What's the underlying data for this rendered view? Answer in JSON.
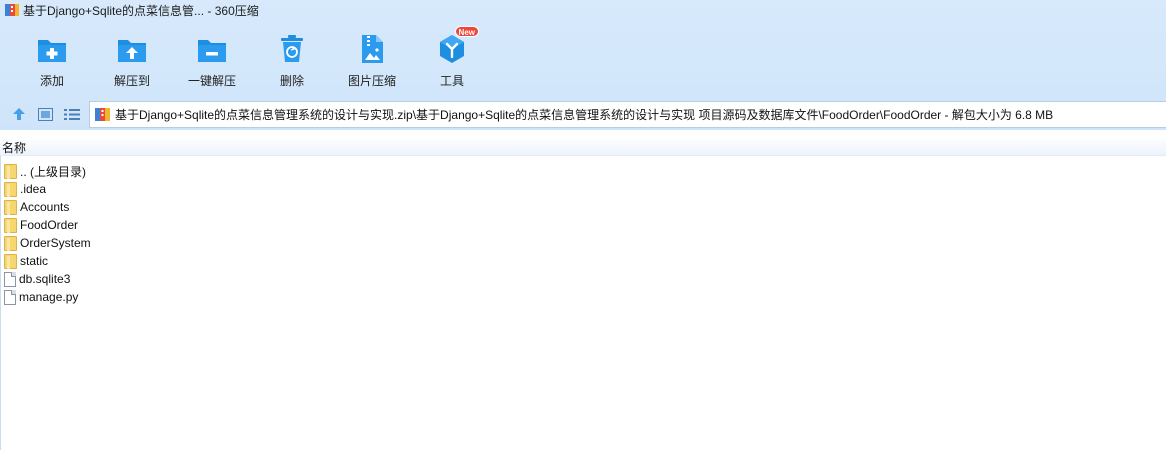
{
  "window": {
    "title": "基于Django+Sqlite的点菜信息管... - 360压缩"
  },
  "toolbar": {
    "items": [
      {
        "label": "添加",
        "icon": "add-icon"
      },
      {
        "label": "解压到",
        "icon": "extract-to-icon"
      },
      {
        "label": "一键解压",
        "icon": "one-click-extract-icon"
      },
      {
        "label": "删除",
        "icon": "delete-icon"
      },
      {
        "label": "图片压缩",
        "icon": "image-compress-icon"
      },
      {
        "label": "工具",
        "icon": "tools-icon",
        "badge": "New"
      }
    ]
  },
  "address": {
    "path": "基于Django+Sqlite的点菜信息管理系统的设计与实现.zip\\基于Django+Sqlite的点菜信息管理系统的设计与实现 项目源码及数据库文件\\FoodOrder\\FoodOrder - 解包大小为 6.8 MB"
  },
  "list": {
    "column_name": "名称",
    "items": [
      {
        "name": ".. (上级目录)",
        "type": "folder"
      },
      {
        "name": ".idea",
        "type": "folder"
      },
      {
        "name": "Accounts",
        "type": "folder"
      },
      {
        "name": "FoodOrder",
        "type": "folder"
      },
      {
        "name": "OrderSystem",
        "type": "folder"
      },
      {
        "name": "static",
        "type": "folder"
      },
      {
        "name": "db.sqlite3",
        "type": "file"
      },
      {
        "name": "manage.py",
        "type": "file"
      }
    ]
  },
  "colors": {
    "accent": "#1e8fe0",
    "toolbar_bg": "#d5e8fb",
    "badge": "#f0453a"
  }
}
